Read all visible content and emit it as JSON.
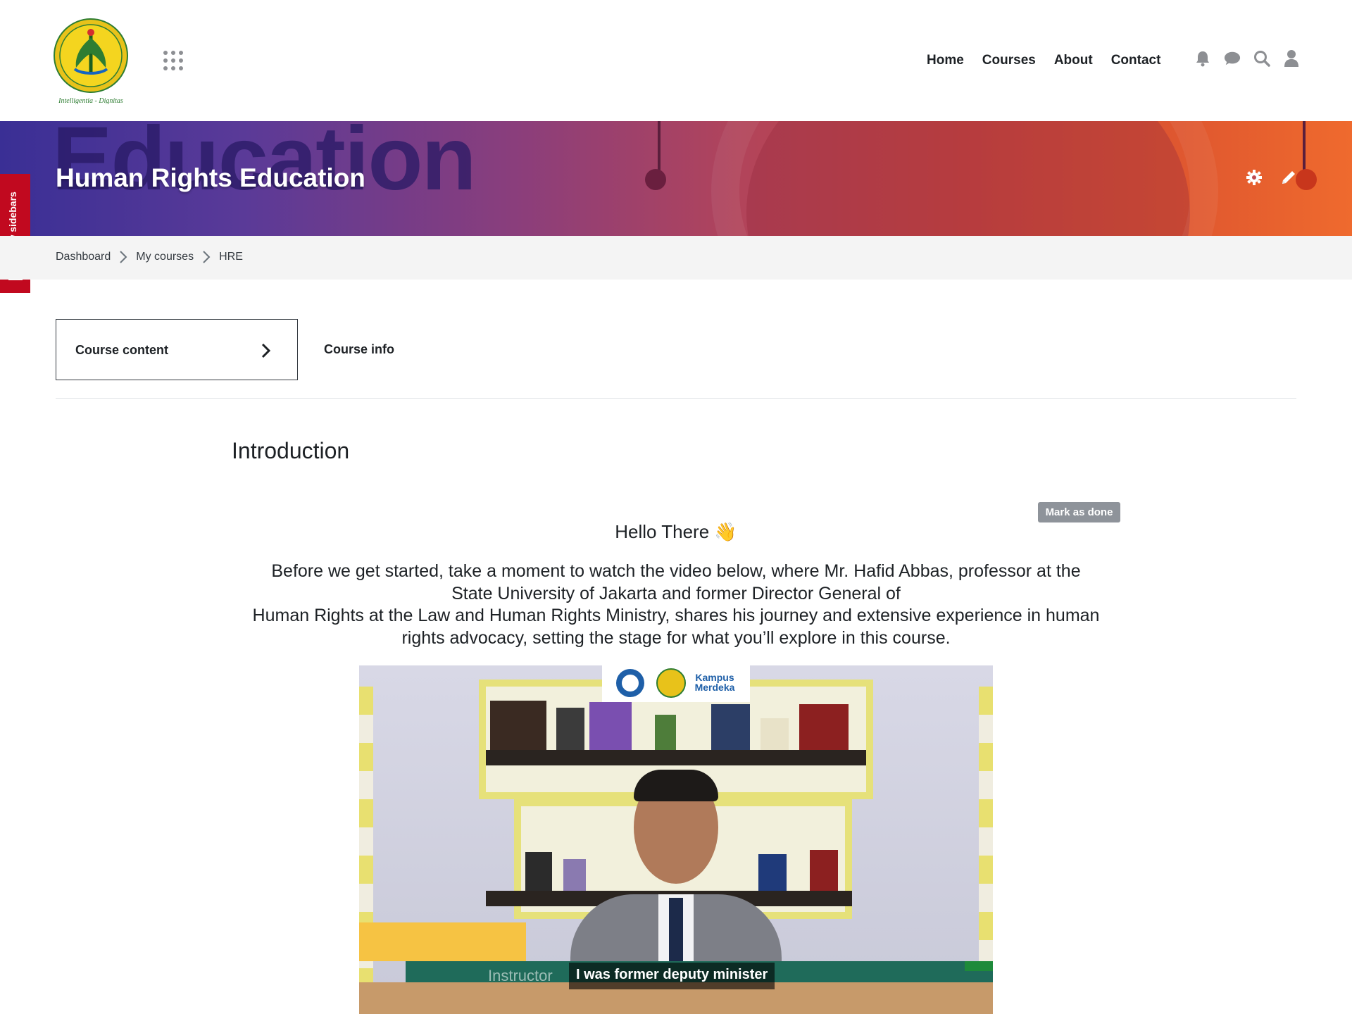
{
  "header": {
    "logo_alt": "Universitas Negeri Jakarta",
    "logo_motto": "Intelligentia - Dignitas",
    "nav": [
      "Home",
      "Courses",
      "About",
      "Contact"
    ],
    "icons": [
      "bell-icon",
      "chat-icon",
      "search-icon",
      "user-icon"
    ]
  },
  "banner": {
    "title": "Human Rights Education",
    "ghost_text": "Education"
  },
  "sidebar_toggle": {
    "label": "Show sidebars"
  },
  "breadcrumb": [
    "Dashboard",
    "My courses",
    "HRE"
  ],
  "tabs": {
    "content": "Course content",
    "info": "Course info"
  },
  "section": {
    "title": "Introduction",
    "mark_done": "Mark as done",
    "greeting": "Hello There 👋",
    "intro_line1": "Before we get started, take a moment to watch the video below, where Mr. Hafid Abbas, professor at the",
    "intro_line2": "State University of Jakarta and former Director General of",
    "intro_line3": "Human Rights at the Law and Human Rights Ministry, shares his journey and extensive experience in human",
    "intro_line4": "rights advocacy, setting the stage for what you’ll explore in this course."
  },
  "video": {
    "lower_third": "Instructor",
    "caption": "I was former deputy minister"
  },
  "colors": {
    "accent_red": "#c1091f",
    "banner_start": "#3a2f95",
    "banner_end": "#ef6a2e"
  }
}
